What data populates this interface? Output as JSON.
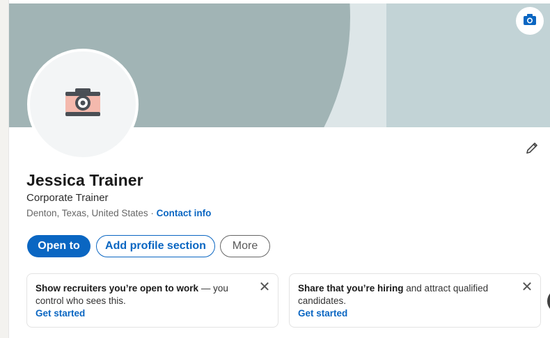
{
  "profile": {
    "name": "Jessica Trainer",
    "headline": "Corporate Trainer",
    "location": "Denton, Texas, United States",
    "separator": " · ",
    "contact_info_label": "Contact info"
  },
  "banner": {
    "camera_icon": "camera-icon",
    "colors": {
      "base": "#c2d3d6",
      "stripe": "#dde6e8",
      "ellipse": "#a1b4b5"
    }
  },
  "avatar": {
    "icon": "camera-icon"
  },
  "edit_icon": "pencil-icon",
  "actions": {
    "open_to_label": "Open to",
    "add_section_label": "Add profile section",
    "more_label": "More"
  },
  "promos": [
    {
      "bold": "Show recruiters you’re open to work",
      "rest": " — you control who sees this.",
      "link": "Get started",
      "close": "✕"
    },
    {
      "bold": "Share that you’re hiring",
      "rest": " and attract qualified candidates.",
      "link": "Get started",
      "close": "✕"
    }
  ],
  "carousel": {
    "next_glyph": "›"
  },
  "colors": {
    "accent": "#0a66c2",
    "text": "#1a1a1a",
    "muted": "#666666"
  }
}
